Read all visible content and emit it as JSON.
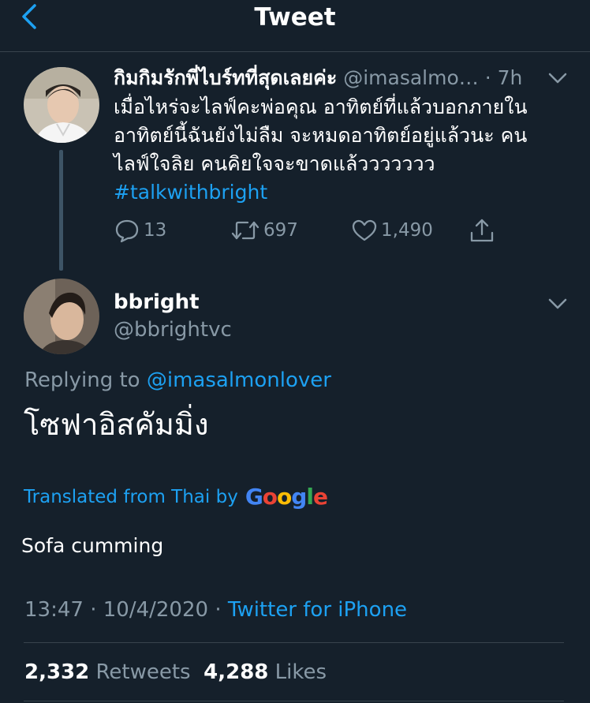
{
  "header": {
    "title": "Tweet"
  },
  "parent_tweet": {
    "name": "กิมกิมรักพี่ไบร์ทที่สุดเลยค่ะ",
    "handle": "@imasalmo…",
    "time": "· 7h",
    "lines": [
      "เมื่อไหร่จะไลฟ์คะพ่อคุณ อาทิตย์ที่แล้วบอกภายใน",
      "อาทิตย์นี้ฉันยังไม่ลืม จะหมดอาทิตย์อยู่แล้วนะ คน",
      "ไลฟ์ใจลิย คนคิยใจจะขาดแล้ววววววว"
    ],
    "hashtag": "#talkwithbright",
    "stats": {
      "replies": "13",
      "retweets": "697",
      "likes": "1,490"
    }
  },
  "main_tweet": {
    "name": "bbright",
    "handle": "@bbrightvc",
    "replying_prefix": "Replying to",
    "replying_to": "@imasalmonlover",
    "text": "โซฟาอิสคัมมิ่ง",
    "translated_label": "Translated from Thai by",
    "translation": "Sofa cumming",
    "time": "13:47",
    "date": "10/4/2020",
    "separator": "·",
    "source": "Twitter for iPhone",
    "retweets_count": "2,332",
    "retweets_label": "Retweets",
    "likes_count": "4,288",
    "likes_label": "Likes"
  },
  "colors": {
    "background": "#15202b",
    "accent": "#1da1f2",
    "muted": "#8899a6",
    "divider": "#38444d"
  },
  "icons": [
    "back-chevron-icon",
    "chevron-down-icon",
    "reply-icon",
    "retweet-icon",
    "heart-icon",
    "share-icon",
    "google-logo"
  ]
}
